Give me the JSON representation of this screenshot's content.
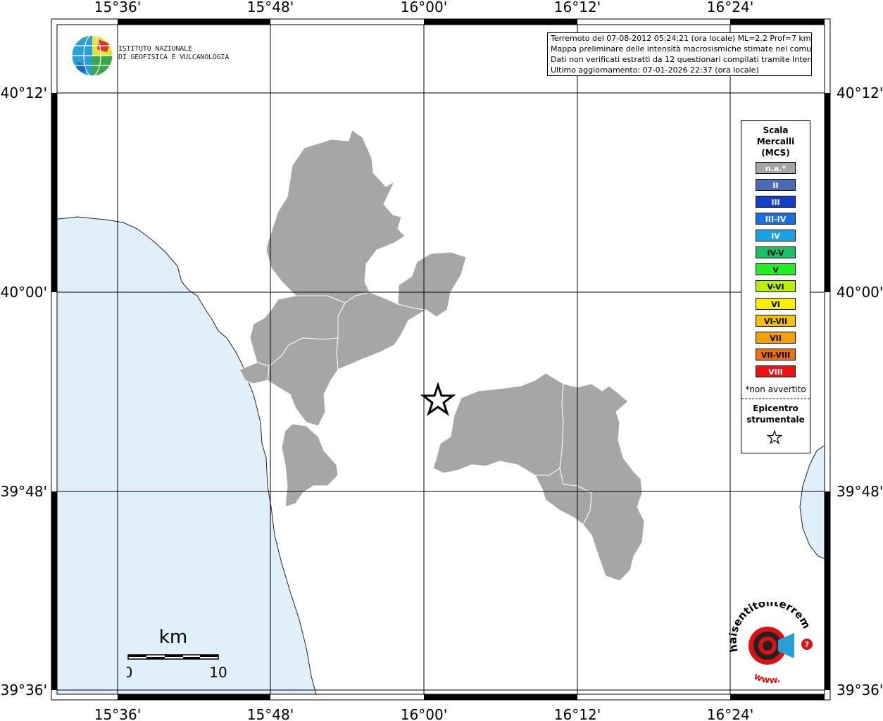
{
  "map": {
    "top_ticks": [
      "15°36'",
      "15°48'",
      "16°00'",
      "16°12'",
      "16°24'"
    ],
    "bottom_ticks": [
      "15°36'",
      "15°48'",
      "16°00'",
      "16°12'",
      "16°24'"
    ],
    "left_ticks": [
      "40°12'",
      "40°00'",
      "39°48'",
      "39°36'"
    ],
    "right_ticks": [
      "40°12'",
      "40°00'",
      "39°48'",
      "39°36'"
    ],
    "colors": {
      "sea": "#dff0fb",
      "municipality": "#a6a6a6",
      "frame": "#000000"
    }
  },
  "info": {
    "lines": [
      "Terremoto del 07-08-2012 05:24:21 (ora locale) ML=2.2 Prof=7 km",
      "Mappa preliminare delle intensità macrosismiche stimate nei comuni",
      "Dati non verificati estratti da 12 questionari compilati tramite Internet.",
      "Ultimo aggiornamento: 07-01-2026 22:37 (ora locale)"
    ]
  },
  "ingv_logo": {
    "line1": "ISTITUTO NAZIONALE",
    "line2": "DI GEOFISICA E VULCANOLOGIA"
  },
  "legend": {
    "title_1": "Scala",
    "title_2": "Mercalli",
    "title_3": "(MCS)",
    "items": [
      {
        "label": "n.a.*",
        "color": "#a6a6a6"
      },
      {
        "label": "II",
        "color": "#4a6bb5"
      },
      {
        "label": "III",
        "color": "#1040c8"
      },
      {
        "label": "III-IV",
        "color": "#1a6fe0"
      },
      {
        "label": "IV",
        "color": "#1aa0e8"
      },
      {
        "label": "IV-V",
        "color": "#18c06a"
      },
      {
        "label": "V",
        "color": "#22ee22"
      },
      {
        "label": "V-VI",
        "color": "#b8f000"
      },
      {
        "label": "VI",
        "color": "#f8f000"
      },
      {
        "label": "VI-VII",
        "color": "#f5c000"
      },
      {
        "label": "VII",
        "color": "#f8a000"
      },
      {
        "label": "VII-VIII",
        "color": "#f07000"
      },
      {
        "label": "VIII",
        "color": "#ee1010"
      }
    ],
    "note": "*non avvertito",
    "epicenter_1": "Epicentro",
    "epicenter_2": "strumentale"
  },
  "scalebar": {
    "unit": "km",
    "min": "0",
    "max": "10"
  },
  "hs_logo": {
    "text": "haisentitoilterremoto.it",
    "www": "www."
  }
}
